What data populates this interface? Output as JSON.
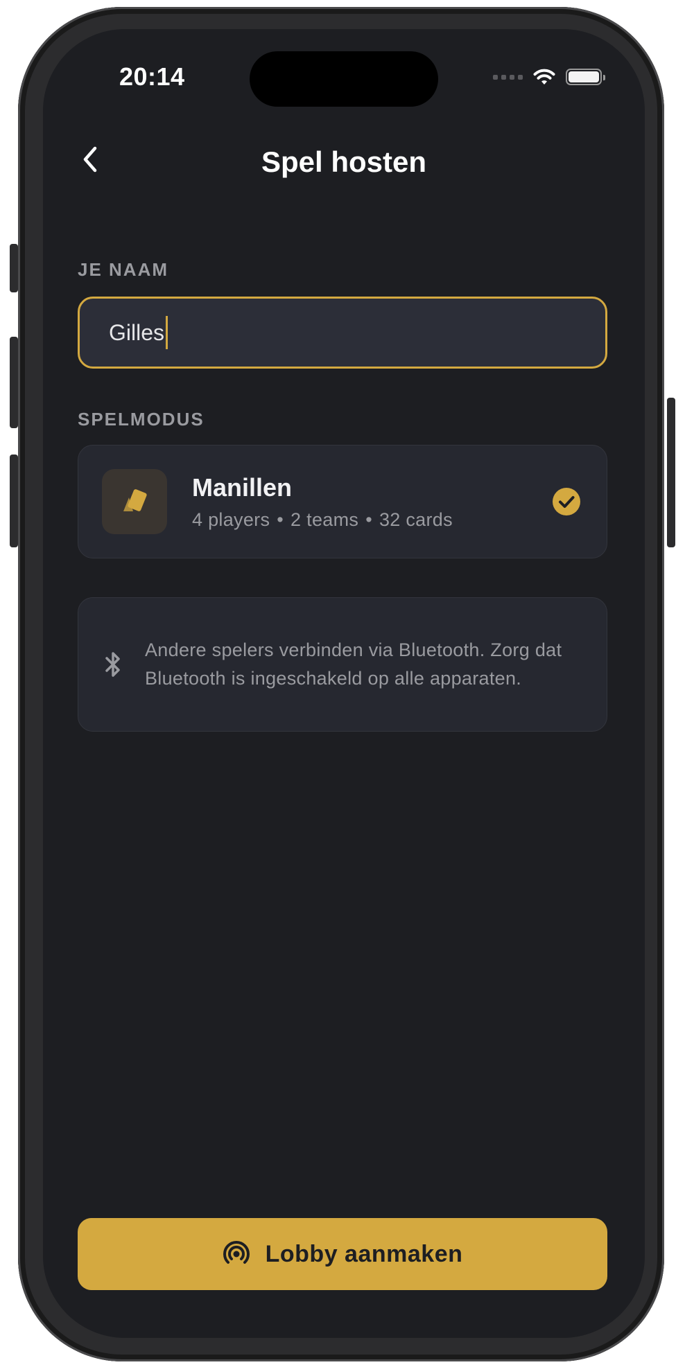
{
  "status_bar": {
    "time": "20:14"
  },
  "header": {
    "title": "Spel hosten"
  },
  "name_section": {
    "label": "JE NAAM",
    "value": "Gilles"
  },
  "mode_section": {
    "label": "SPELMODUS",
    "mode": {
      "title": "Manillen",
      "players": "4 players",
      "teams": "2 teams",
      "cards": "32 cards",
      "separator": "•",
      "selected": true
    }
  },
  "info": {
    "text": "Andere spelers verbinden via Bluetooth. Zorg dat Bluetooth is ingeschakeld op alle apparaten."
  },
  "primary_button": {
    "label": "Lobby aanmaken"
  },
  "colors": {
    "accent": "#d4a940",
    "background": "#1d1e22",
    "card": "#262830",
    "input": "#2c2e38",
    "muted_text": "#9a9ba0"
  },
  "icons": [
    "back-chevron-icon",
    "wifi-icon",
    "battery-icon",
    "cards-icon",
    "check-circle-icon",
    "bluetooth-icon",
    "broadcast-icon"
  ]
}
